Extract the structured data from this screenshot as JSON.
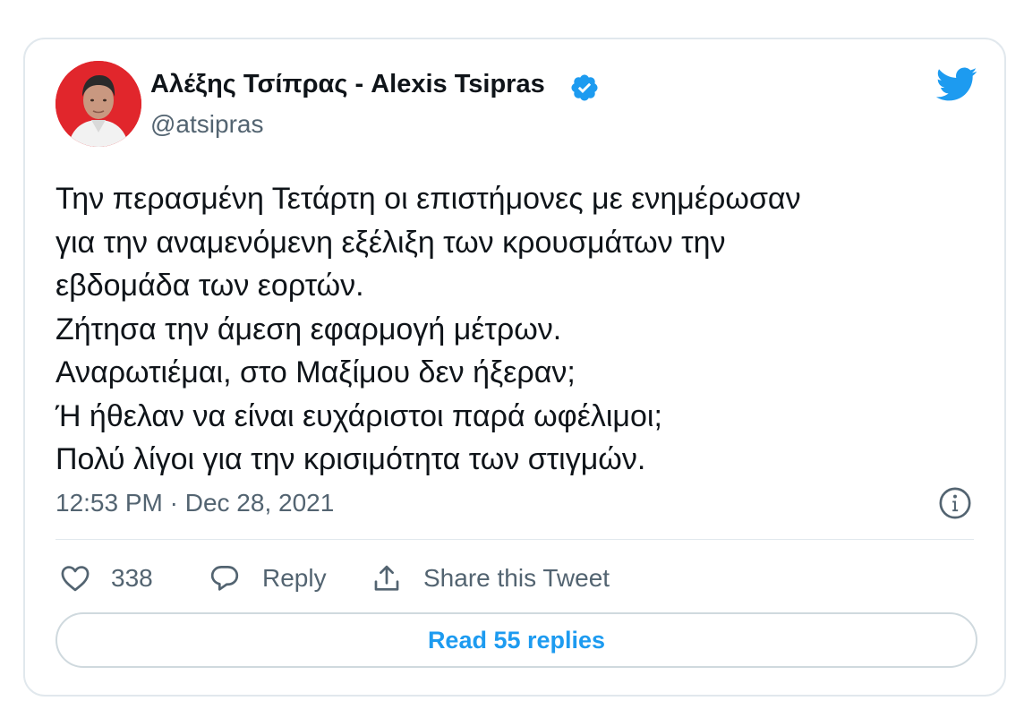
{
  "author": {
    "name": "Αλέξης Τσίπρας - Alexis Tsipras",
    "handle": "@atsipras",
    "verified": true,
    "avatar_bg": "#e1262c"
  },
  "brand": {
    "logo_icon": "twitter-bird-icon",
    "color": "#1d9bf0"
  },
  "tweet": {
    "lines": [
      "Την περασμένη Τετάρτη οι επιστήμονες με ενημέρωσαν",
      "για την αναμενόμενη εξέλιξη των κρουσμάτων την",
      "εβδομάδα των εορτών.",
      "Ζήτησα την άμεση εφαρμογή μέτρων.",
      "Αναρωτιέμαι, στο Μαξίμου δεν ήξεραν;",
      "Ή ήθελαν να είναι ευχάριστοι παρά ωφέλιμοι;",
      "Πολύ λίγοι για την κρισιμότητα των στιγμών."
    ],
    "timestamp": "12:53 PM · Dec 28, 2021"
  },
  "actions": {
    "like_icon": "heart-icon",
    "like_count": "338",
    "reply_icon": "speech-bubble-icon",
    "reply_label": "Reply",
    "share_icon": "share-upload-icon",
    "share_label": "Share this Tweet",
    "info_icon": "info-icon"
  },
  "read_replies_label": "Read 55 replies"
}
